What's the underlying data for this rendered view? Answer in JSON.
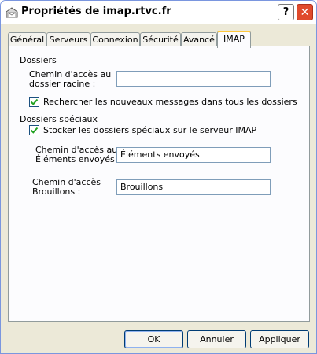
{
  "window": {
    "title": "Propriétés de imap.rtvc.fr",
    "help_label": "?",
    "close_label": "✕"
  },
  "tabs": [
    {
      "label": "Général",
      "active": false
    },
    {
      "label": "Serveurs",
      "active": false
    },
    {
      "label": "Connexion",
      "active": false
    },
    {
      "label": "Sécurité",
      "active": false
    },
    {
      "label": "Avancé",
      "active": false
    },
    {
      "label": "IMAP",
      "active": true
    }
  ],
  "dossiers": {
    "group_label": "Dossiers",
    "root_path_label_line1": "Chemin d'accès au",
    "root_path_label_line2": "dossier racine :",
    "root_path_value": "",
    "check_new_messages_label": "Rechercher les nouveaux messages dans tous les dossiers",
    "check_new_messages_checked": true
  },
  "special": {
    "group_label": "Dossiers spéciaux",
    "store_on_server_label": "Stocker les dossiers spéciaux sur le serveur IMAP",
    "store_on_server_checked": true,
    "sent_label_line1": "Chemin d'accès aux",
    "sent_label_line2": "Éléments envoyés :",
    "sent_value": "Éléments envoyés",
    "drafts_label_line1": "Chemin d'accès",
    "drafts_label_line2": "Brouillons :",
    "drafts_value": "Brouillons"
  },
  "buttons": {
    "ok": "OK",
    "cancel": "Annuler",
    "apply": "Appliquer"
  }
}
